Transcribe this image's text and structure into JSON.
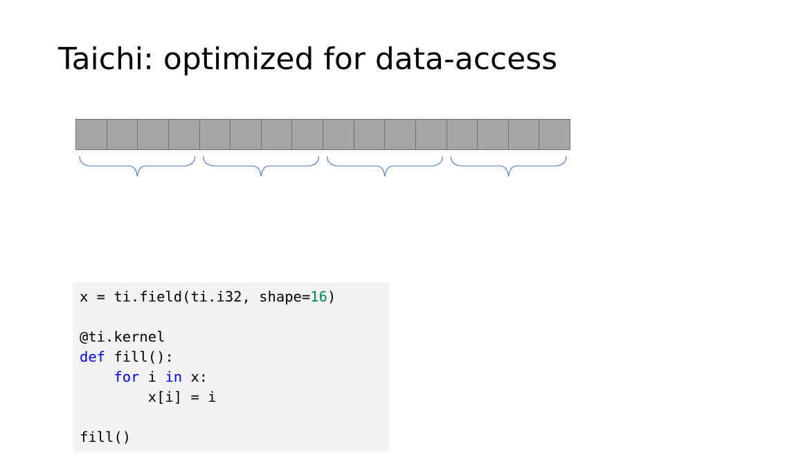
{
  "slide": {
    "title": "Taichi: optimized for data-access"
  },
  "array": {
    "cell_count": 16,
    "group_size": 4,
    "group_count": 4,
    "cell_color": "#a6a6a6",
    "cell_border_color": "#6f6f6f",
    "brace_color": "#4472c4"
  },
  "code": {
    "line1": {
      "prefix": "x = ti.field(ti.i32, shape=",
      "number": "16",
      "suffix": ")"
    },
    "line2": {
      "text": "@ti.kernel"
    },
    "line3": {
      "kw": "def",
      "rest": " fill():"
    },
    "line4": {
      "indent": "    ",
      "kw_for": "for",
      "mid": " i ",
      "kw_in": "in",
      "rest": " x:"
    },
    "line5": {
      "text": "        x[i] = i"
    },
    "line6": {
      "text": "fill()"
    },
    "background": "#f2f2f2",
    "keyword_color": "#0000ee",
    "number_color": "#00875a"
  }
}
